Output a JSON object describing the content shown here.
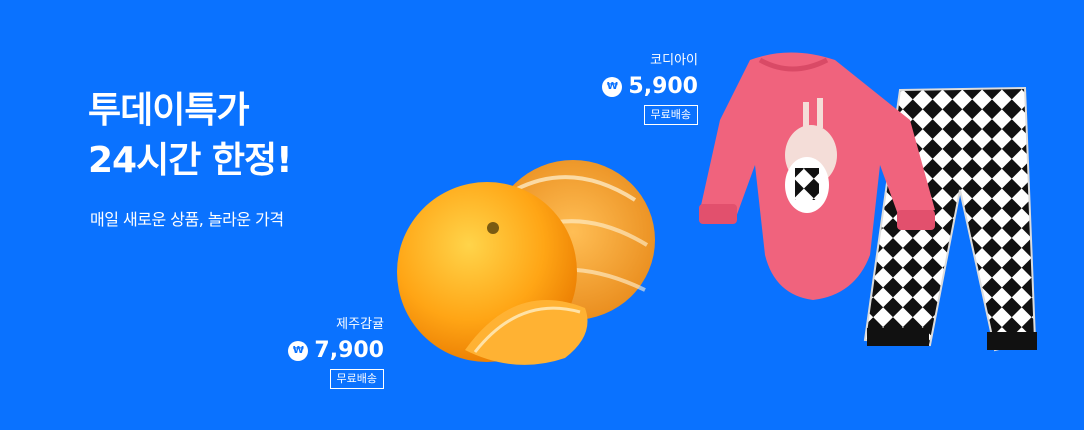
{
  "banner": {
    "headline_line1": "투데이특가",
    "headline_line2": "24시간 한정!",
    "subtitle": "매일 새로운 상품, 놀라운 가격"
  },
  "products": {
    "baby": {
      "name": "코디아이",
      "price": "5,900",
      "shipping": "무료배송"
    },
    "orange": {
      "name": "제주감귤",
      "price": "7,900",
      "shipping": "무료배송"
    }
  },
  "icons": {
    "currency": "won-icon"
  },
  "colors": {
    "background": "#0a72ff",
    "text": "#ffffff"
  }
}
